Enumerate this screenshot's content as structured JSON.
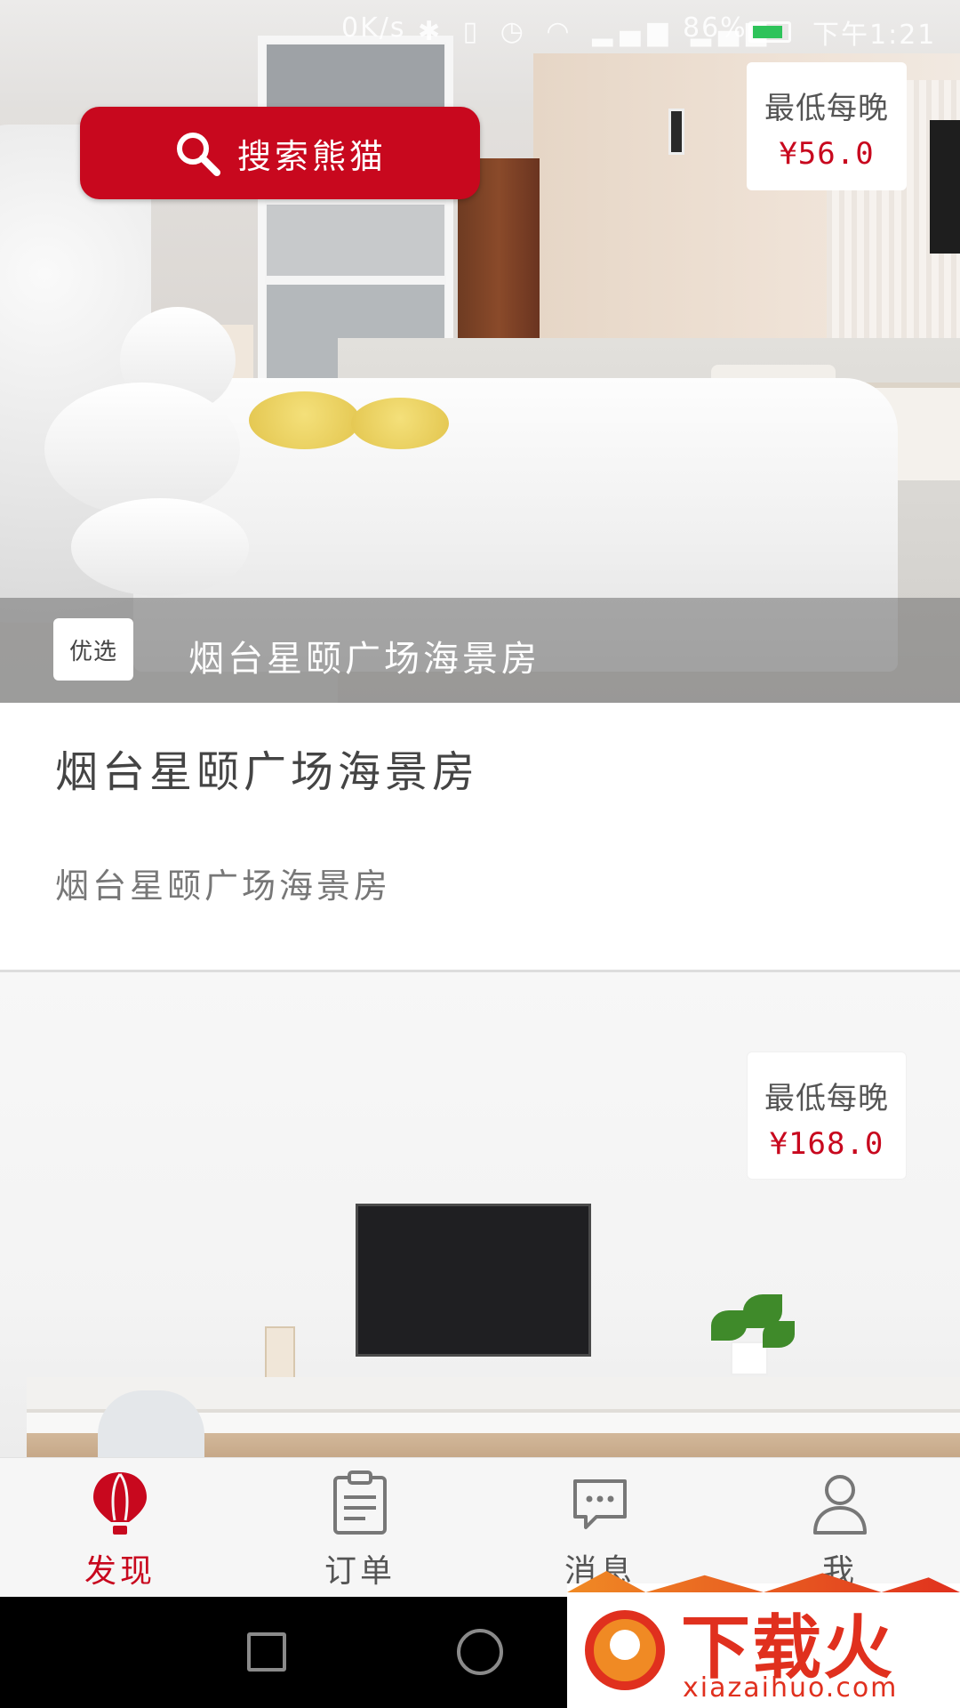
{
  "status_bar": {
    "speed": "0K/s",
    "battery": "86%",
    "battery_level": 0.86,
    "time": "下午1:21"
  },
  "search": {
    "label": "搜索熊猫",
    "icon": "search-icon"
  },
  "listings": [
    {
      "price_caption": "最低每晚",
      "price": "¥56.0",
      "badge": "优选",
      "overlay_title": "烟台星颐广场海景房",
      "title": "烟台星颐广场海景房",
      "subtitle": "烟台星颐广场海景房"
    },
    {
      "price_caption": "最低每晚",
      "price": "¥168.0"
    }
  ],
  "tabs": [
    {
      "label": "发现",
      "icon": "hot-air-balloon-icon",
      "active": true
    },
    {
      "label": "订单",
      "icon": "clipboard-icon",
      "active": false
    },
    {
      "label": "消息",
      "icon": "chat-bubble-icon",
      "active": false
    },
    {
      "label": "我",
      "icon": "user-icon",
      "active": false
    }
  ],
  "watermark": {
    "brand": "下载火",
    "url": "xiazaihuo.com"
  },
  "colors": {
    "accent": "#c8081e",
    "tab_inactive": "#555555",
    "nav_bar": "#000000"
  }
}
